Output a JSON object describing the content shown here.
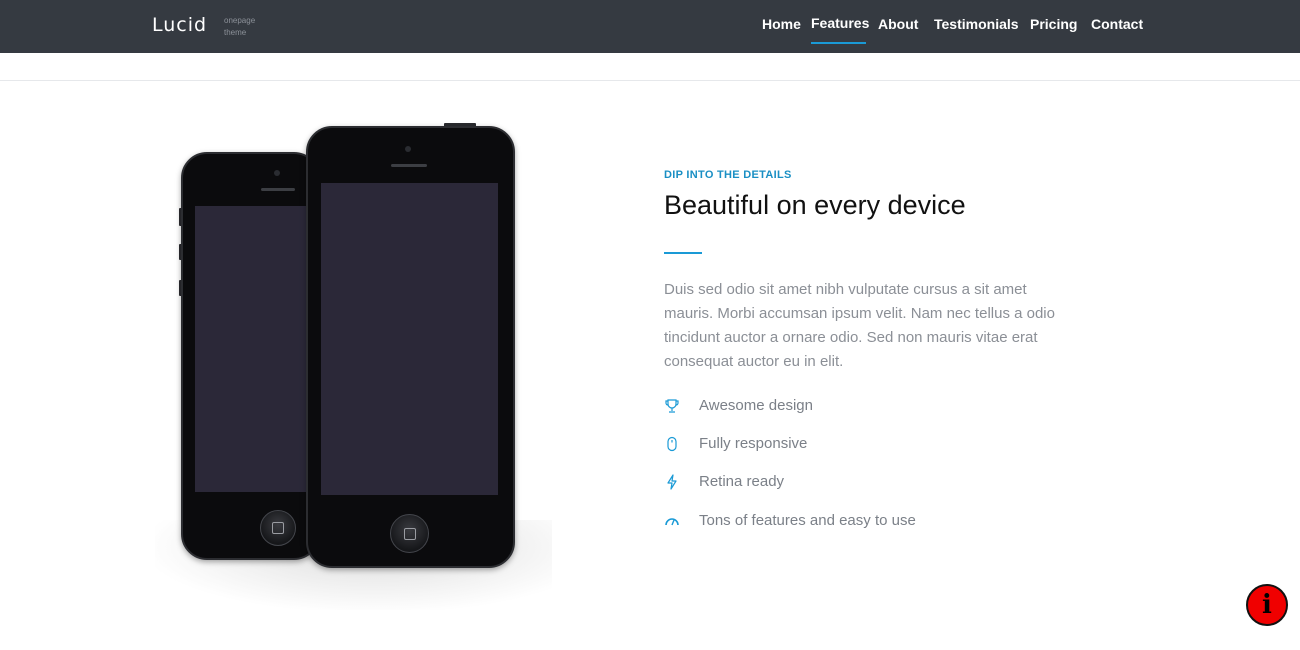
{
  "navbar": {
    "brand": "Lucid",
    "tagline": "onepage theme",
    "items": [
      {
        "label": "Home"
      },
      {
        "label": "Features",
        "active": true
      },
      {
        "label": "About"
      },
      {
        "label": "Testimonials"
      },
      {
        "label": "Pricing"
      },
      {
        "label": "Contact"
      }
    ]
  },
  "section": {
    "eyebrow": "DIP INTO THE DETAILS",
    "heading": "Beautiful on every device",
    "description": "Duis sed odio sit amet nibh vulputate cursus a sit amet mauris. Morbi accumsan ipsum velit. Nam nec tellus a odio tincidunt auctor a ornare odio. Sed non mauris vitae erat consequat auctor eu in elit.",
    "features": [
      {
        "icon": "trophy-icon",
        "label": "Awesome design"
      },
      {
        "icon": "mouse-icon",
        "label": "Fully responsive"
      },
      {
        "icon": "lightning-icon",
        "label": "Retina ready"
      },
      {
        "icon": "gauge-icon",
        "label": "Tons of features and easy to use"
      }
    ]
  },
  "info_button": {
    "icon": "info-icon",
    "glyph": "i"
  },
  "colors": {
    "navbar_bg": "#353a41",
    "accent": "#1a9ad6",
    "heading": "#111111",
    "body_text": "#8b8f96",
    "info_button": "#f00000"
  }
}
